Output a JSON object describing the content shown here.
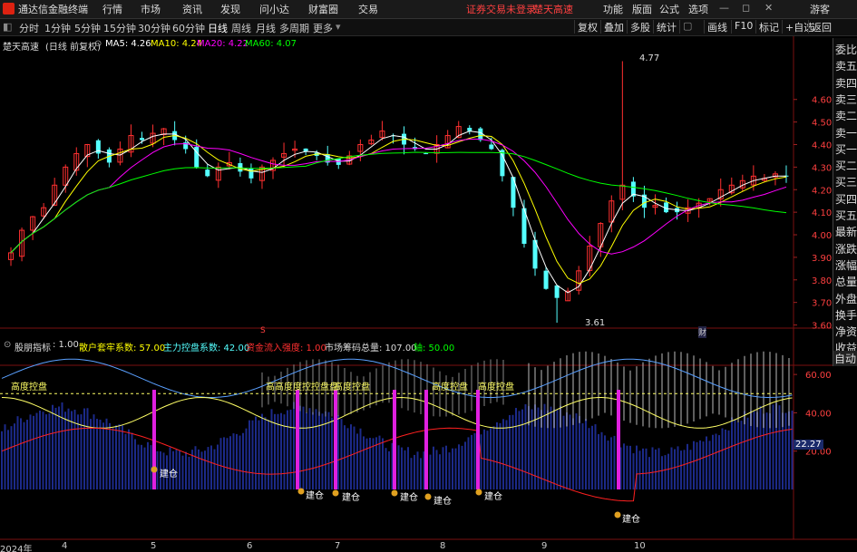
{
  "titlebar": {
    "app_name": "通达信金融终端",
    "menus": [
      "行情",
      "市场",
      "资讯",
      "发现",
      "问小达",
      "财富圈",
      "交易"
    ],
    "notice": "证券交易未登录",
    "stock": "楚天高速",
    "right_menus": [
      "功能",
      "版面",
      "公式",
      "选项"
    ],
    "guest": "游客"
  },
  "tabbar": {
    "periods": [
      "分时",
      "1分钟",
      "5分钟",
      "15分钟",
      "30分钟",
      "60分钟",
      "日线",
      "周线",
      "月线",
      "多周期",
      "更多"
    ],
    "active": "日线",
    "tools": [
      "复权",
      "叠加",
      "多股",
      "统计",
      "画线",
      "F10",
      "标记",
      "+自选",
      "返回"
    ]
  },
  "main_chart": {
    "name": "楚天高速",
    "mode": "(日线 前复权)",
    "ma5": "MA5: 4.26",
    "ma10": "MA10: 4.24",
    "ma20": "MA20: 4.22",
    "ma60": "MA60: 4.07",
    "high_label": "4.77",
    "low_label": "3.61",
    "marker_s": "S",
    "marker_cai": "财",
    "colors": {
      "up": "#ff3030",
      "down": "#54ffff",
      "ma5": "#ffffff",
      "ma10": "#ffff00",
      "ma20": "#ff00ff",
      "ma60": "#00ff00"
    }
  },
  "sidebar": [
    "委比",
    "卖五",
    "卖四",
    "卖三",
    "卖二",
    "卖一",
    "买一",
    "买二",
    "买三",
    "买四",
    "买五",
    "最新",
    "涨跌",
    "涨幅",
    "总量",
    "外盘",
    "换手",
    "净资",
    "收益"
  ],
  "sub_chart": {
    "name": "股朋指标",
    "p1": ": 1.00",
    "p2": "散户套牢系数: 57.00",
    "p3": "主力控盘系数: 42.00",
    "p4": "资金流入强度: 1.00",
    "p5": "市场筹码总量: 107.00",
    "p6": "轴: 50.00",
    "auto_button": "自动",
    "value_tag": "22.27",
    "signal_label": "高度控盘",
    "build_label": "建仓",
    "overlap_label": "高高度度控控盘盘"
  },
  "xaxis": {
    "year": "2024年",
    "months": [
      "4",
      "5",
      "6",
      "7",
      "8",
      "9",
      "10"
    ]
  },
  "chart_data": {
    "type": "line",
    "title": "楚天高速 (日线 前复权)",
    "price_axis": {
      "ticks": [
        4.6,
        4.5,
        4.4,
        4.3,
        4.2,
        4.1,
        4.0,
        3.9,
        3.8,
        3.7,
        3.6
      ],
      "ylim": [
        3.57,
        4.82
      ]
    },
    "indicator_axis": {
      "ticks": [
        60.0,
        40.0,
        20.0
      ],
      "ylim": [
        0,
        70
      ]
    },
    "ma": {
      "MA5": 4.26,
      "MA10": 4.24,
      "MA20": 4.22,
      "MA60": 4.07
    },
    "high": 4.77,
    "low": 3.61,
    "close_points": [
      3.92,
      4.02,
      4.08,
      4.12,
      4.22,
      4.3,
      4.36,
      4.4,
      4.36,
      4.32,
      4.38,
      4.44,
      4.42,
      4.45,
      4.47,
      4.42,
      4.38,
      4.3,
      4.26,
      4.3,
      4.32,
      4.28,
      4.25,
      4.3,
      4.33,
      4.36,
      4.38,
      4.37,
      4.35,
      4.32,
      4.31,
      4.35,
      4.4,
      4.42,
      4.46,
      4.44,
      4.4,
      4.38,
      4.36,
      4.4,
      4.44,
      4.48,
      4.46,
      4.42,
      4.38,
      4.26,
      4.12,
      3.96,
      3.85,
      3.76,
      3.72,
      3.75,
      3.84,
      3.95,
      4.05,
      4.15,
      4.22,
      4.17,
      4.12,
      4.13,
      4.1,
      4.1,
      4.12,
      4.14,
      4.16,
      4.2,
      4.22,
      4.24,
      4.26,
      4.25,
      4.27,
      4.26
    ]
  }
}
